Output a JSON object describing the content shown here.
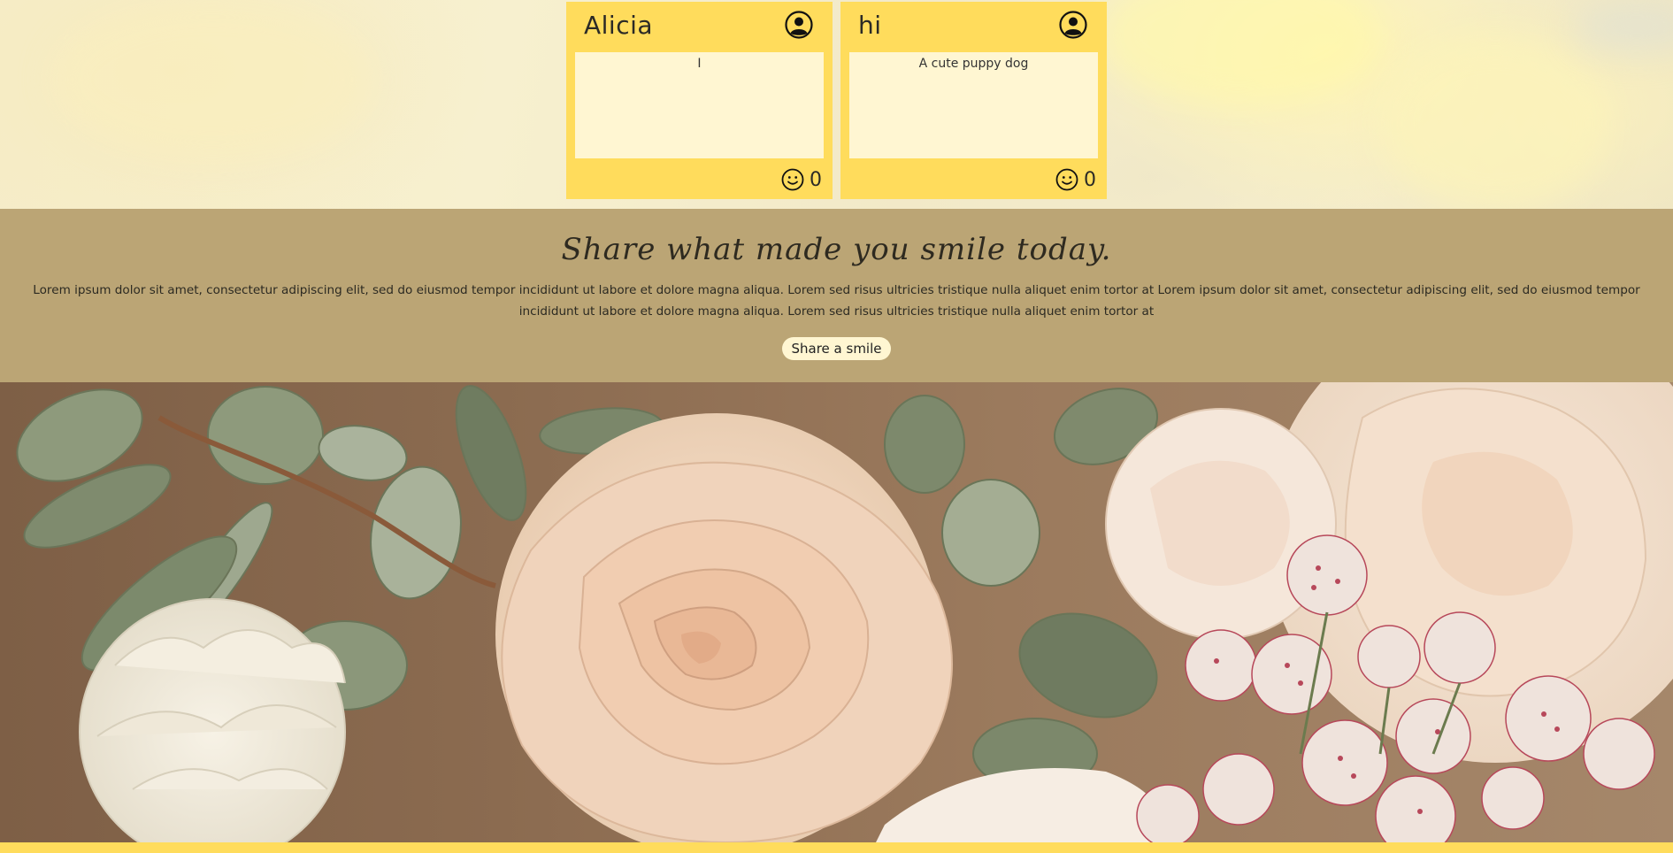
{
  "cards": [
    {
      "name": "Alicia",
      "message": "I",
      "smile_count": "0"
    },
    {
      "name": "hi",
      "message": "A cute puppy dog",
      "smile_count": "0"
    }
  ],
  "band": {
    "title": "Share what made you smile today.",
    "text": "Lorem ipsum dolor sit amet, consectetur adipiscing elit, sed do eiusmod tempor incididunt ut labore et dolore magna aliqua. Lorem sed risus ultricies tristique nulla aliquet enim tortor at Lorem ipsum dolor sit amet, consectetur adipiscing elit, sed do eiusmod tempor incididunt ut labore et dolore magna aliqua. Lorem sed risus ultricies tristique nulla aliquet enim tortor at",
    "button_label": "Share a smile"
  },
  "icons": {
    "avatar": "user-circle-icon",
    "smile": "smiley-face-icon"
  },
  "colors": {
    "card_yellow": "#ffdc5c",
    "card_body": "#fff6d2",
    "band_tan": "#bba575",
    "button_bg": "#fff6d2"
  }
}
